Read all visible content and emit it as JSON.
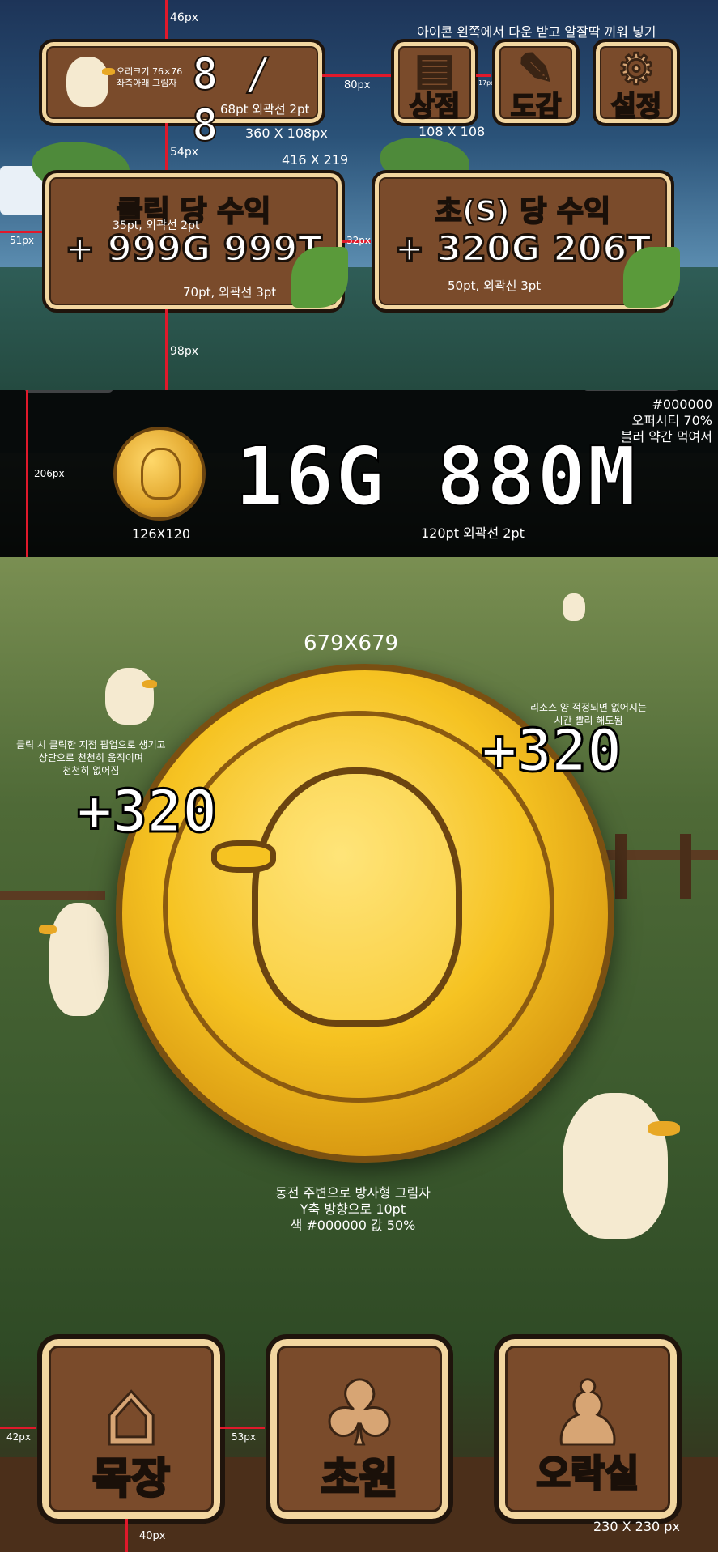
{
  "top_note": "아이콘 왼쪽에서 다운 받고 알잘딱 끼워 넣기",
  "duck_counter": {
    "icon_note": "오리크기 76×76\n좌측아래 그림자",
    "value": "8 / 8",
    "font_note": "68pt 외곽선 2pt",
    "size_note": "360 X 108px"
  },
  "menu_buttons": [
    {
      "label": "상점",
      "icon": "scroll-icon"
    },
    {
      "label": "도감",
      "icon": "book-icon"
    },
    {
      "label": "설정",
      "icon": "gear-icon"
    }
  ],
  "menu_size_note": "108 X 108",
  "income_panels": {
    "size_note": "416 X 219",
    "per_click": {
      "title": "클릭 당 수익",
      "title_note": "35pt, 외곽선 2pt",
      "value": "+ 999G 999T",
      "value_note": "70pt, 외곽선 3pt"
    },
    "per_second": {
      "title": "초(S) 당 수익",
      "value": "+ 320G 206T",
      "value_note": "50pt, 외곽선 3pt"
    }
  },
  "gold_bar": {
    "amount": "16G 880M",
    "coin_size_note": "126X120",
    "font_note": "120pt 외곽선 2pt",
    "style_note": "#000000\n오퍼시티 70%\n블러 약간 먹여서"
  },
  "dimensions": {
    "d46": "46px",
    "d80": "80px",
    "d17": "17px",
    "d54": "54px",
    "d51": "51px",
    "d32": "32px",
    "d98": "98px",
    "d206": "206px",
    "d42": "42px",
    "d53": "53px",
    "d40": "40px"
  },
  "main_coin": {
    "size_note": "679X679",
    "shadow_note": "동전 주변으로 방사형 그림자\nY축 방향으로 10pt\n색 #000000 값 50%"
  },
  "popups": {
    "left_value": "+320",
    "right_value": "+320",
    "left_note": "클릭 시 클릭한 지점 팝업으로 생기고\n상단으로 천천히 움직이며\n천천히 없어짐",
    "right_note": "리소스 양 적정되면 없어지는\n시간 빨리 해도됨"
  },
  "bottom_nav": {
    "items": [
      {
        "label": "목장",
        "icon": "barn-icon"
      },
      {
        "label": "초원",
        "icon": "meadow-icon"
      },
      {
        "label": "오락실",
        "icon": "joystick-icon"
      }
    ],
    "size_note": "230 X 230 px"
  }
}
